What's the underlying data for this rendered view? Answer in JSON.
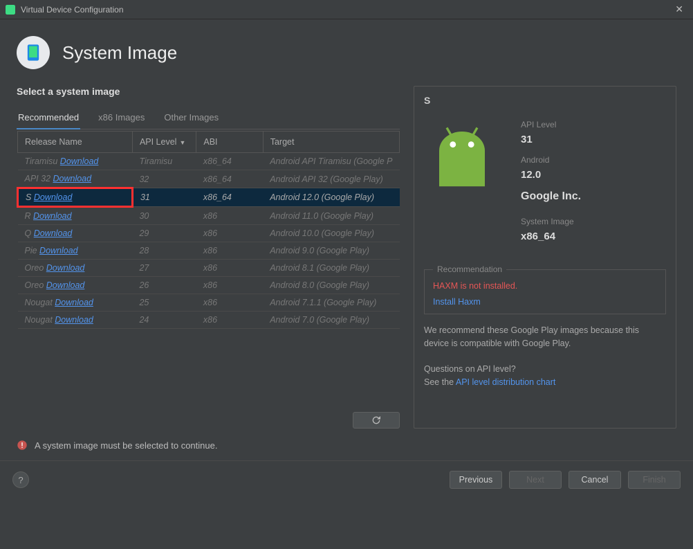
{
  "window": {
    "title": "Virtual Device Configuration"
  },
  "header": {
    "title": "System Image"
  },
  "section": {
    "title": "Select a system image"
  },
  "tabs": [
    {
      "label": "Recommended",
      "active": true
    },
    {
      "label": "x86 Images",
      "active": false
    },
    {
      "label": "Other Images",
      "active": false
    }
  ],
  "columns": {
    "release": "Release Name",
    "api": "API Level",
    "abi": "ABI",
    "target": "Target"
  },
  "rows": [
    {
      "release": "Tiramisu",
      "dl": "Download",
      "api": "Tiramisu",
      "abi": "x86_64",
      "target": "Android API Tiramisu (Google P"
    },
    {
      "release": "API 32",
      "dl": "Download",
      "api": "32",
      "abi": "x86_64",
      "target": "Android API 32 (Google Play)"
    },
    {
      "release": "S",
      "dl": "Download",
      "api": "31",
      "abi": "x86_64",
      "target": "Android 12.0 (Google Play)",
      "selected": true,
      "highlight": true
    },
    {
      "release": "R",
      "dl": "Download",
      "api": "30",
      "abi": "x86",
      "target": "Android 11.0 (Google Play)"
    },
    {
      "release": "Q",
      "dl": "Download",
      "api": "29",
      "abi": "x86",
      "target": "Android 10.0 (Google Play)"
    },
    {
      "release": "Pie",
      "dl": "Download",
      "api": "28",
      "abi": "x86",
      "target": "Android 9.0 (Google Play)"
    },
    {
      "release": "Oreo",
      "dl": "Download",
      "api": "27",
      "abi": "x86",
      "target": "Android 8.1 (Google Play)"
    },
    {
      "release": "Oreo",
      "dl": "Download",
      "api": "26",
      "abi": "x86",
      "target": "Android 8.0 (Google Play)"
    },
    {
      "release": "Nougat",
      "dl": "Download",
      "api": "25",
      "abi": "x86",
      "target": "Android 7.1.1 (Google Play)"
    },
    {
      "release": "Nougat",
      "dl": "Download",
      "api": "24",
      "abi": "x86",
      "target": "Android 7.0 (Google Play)"
    }
  ],
  "details": {
    "name": "S",
    "api_label": "API Level",
    "api_value": "31",
    "android_label": "Android",
    "android_value": "12.0",
    "vendor": "Google Inc.",
    "sysimg_label": "System Image",
    "sysimg_value": "x86_64"
  },
  "recommendation": {
    "legend": "Recommendation",
    "warning": "HAXM is not installed.",
    "install_link": "Install Haxm",
    "text": "We recommend these Google Play images because this device is compatible with Google Play.",
    "question": "Questions on API level?",
    "see_the": "See the ",
    "chart_link": "API level distribution chart"
  },
  "alert": "A system image must be selected to continue.",
  "buttons": {
    "previous": "Previous",
    "next": "Next",
    "cancel": "Cancel",
    "finish": "Finish"
  }
}
